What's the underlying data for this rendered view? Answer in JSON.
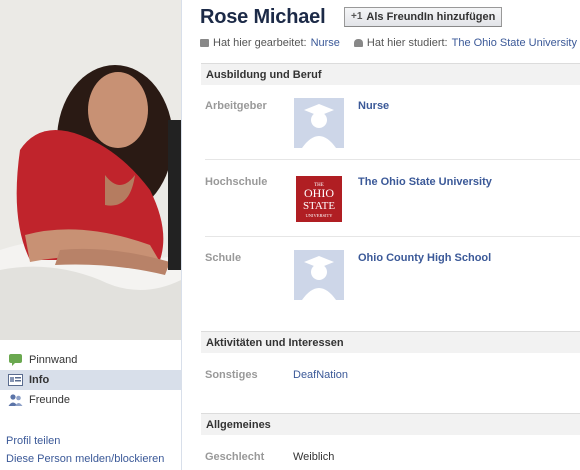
{
  "profile": {
    "name": "Rose Michael",
    "add_friend_label": "Als FreundIn hinzufügen",
    "worked_prefix": "Hat hier gearbeitet:",
    "worked_value": "Nurse",
    "studied_prefix": "Hat hier studiert:",
    "studied_value": "The Ohio State University"
  },
  "nav": {
    "items": [
      {
        "label": "Pinnwand",
        "icon": "wall-icon"
      },
      {
        "label": "Info",
        "icon": "info-icon"
      },
      {
        "label": "Freunde",
        "icon": "friends-icon"
      }
    ],
    "links": [
      "Profil teilen",
      "Diese Person melden/blockieren"
    ]
  },
  "education": {
    "title": "Ausbildung und Beruf",
    "rows": [
      {
        "label": "Arbeitgeber",
        "value": "Nurse"
      },
      {
        "label": "Hochschule",
        "value": "The Ohio State University",
        "logo_text": [
          "THE",
          "OHIO",
          "STATE",
          "UNIVERSITY"
        ]
      },
      {
        "label": "Schule",
        "value": "Ohio County High School"
      }
    ]
  },
  "activities": {
    "title": "Aktivitäten und Interessen",
    "label": "Sonstiges",
    "value": "DeafNation"
  },
  "general": {
    "title": "Allgemeines",
    "label": "Geschlecht",
    "value": "Weiblich"
  },
  "colors": {
    "link": "#3b5998",
    "name": "#1c2a47",
    "section_bg": "#f2f2f2"
  }
}
